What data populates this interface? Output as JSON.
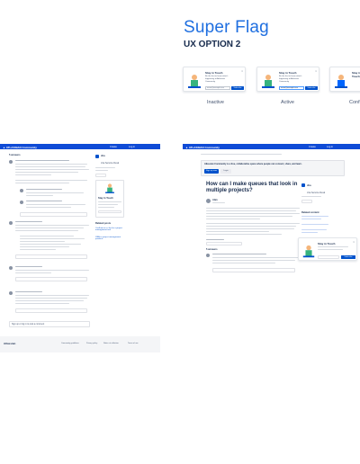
{
  "header": {
    "title": "Super Flag",
    "subtitle": "UX OPTION 2"
  },
  "states": [
    {
      "label": "Inactive",
      "card_title": "Stay in Touch",
      "card_body": "Be the first to know what's happening at Atlassian Community",
      "input_placeholder": "name@example.com",
      "button": "Subscribe"
    },
    {
      "label": "Active",
      "card_title": "Stay in Touch",
      "card_body": "Be the first to know what's happening at Atlassian Community",
      "input_value": "name@example.com",
      "button": "Subscribe"
    },
    {
      "label": "Conf",
      "card_title": "Stay in Touch"
    }
  ],
  "left_mock": {
    "nav": {
      "logo": "▲ ATLASSIAN Community",
      "links": [
        "Create",
        "Log in"
      ]
    },
    "answers_label": "5 answers",
    "sidebar": {
      "user": "Jira",
      "product": "Jira Service Desk",
      "card_title": "Stay in Touch",
      "related_title": "Related posts",
      "related_links": [
        "Confluence or Jira for a project management tool",
        "JIRA vs project management products"
      ]
    },
    "comment_placeholder": "Sign up or log in to post a comment",
    "footer": {
      "logo": "Atlassian",
      "links": [
        "Community guidelines",
        "Privacy policy",
        "Notice at collection",
        "Terms of use"
      ]
    }
  },
  "right_mock": {
    "nav": {
      "logo": "▲ ATLASSIAN Community",
      "links": [
        "Create",
        "Log in"
      ]
    },
    "banner": "Atlassian Community is a free, collaborative space where people can connect, share, and learn.",
    "banner_buttons": [
      "Sign up now",
      "Login"
    ],
    "question": "How can I make queues that look in multiple projects?",
    "user": "Alan",
    "answers_label": "5 answers",
    "sidebar": {
      "user": "Jira",
      "product": "Jira Service Desk",
      "related_title": "Related content",
      "card_title": "Stay in Touch",
      "button": "Subscribe"
    }
  },
  "colors": {
    "accent": "#1f6fe0",
    "nav": "#0f4bd6",
    "button": "#0052cc"
  }
}
